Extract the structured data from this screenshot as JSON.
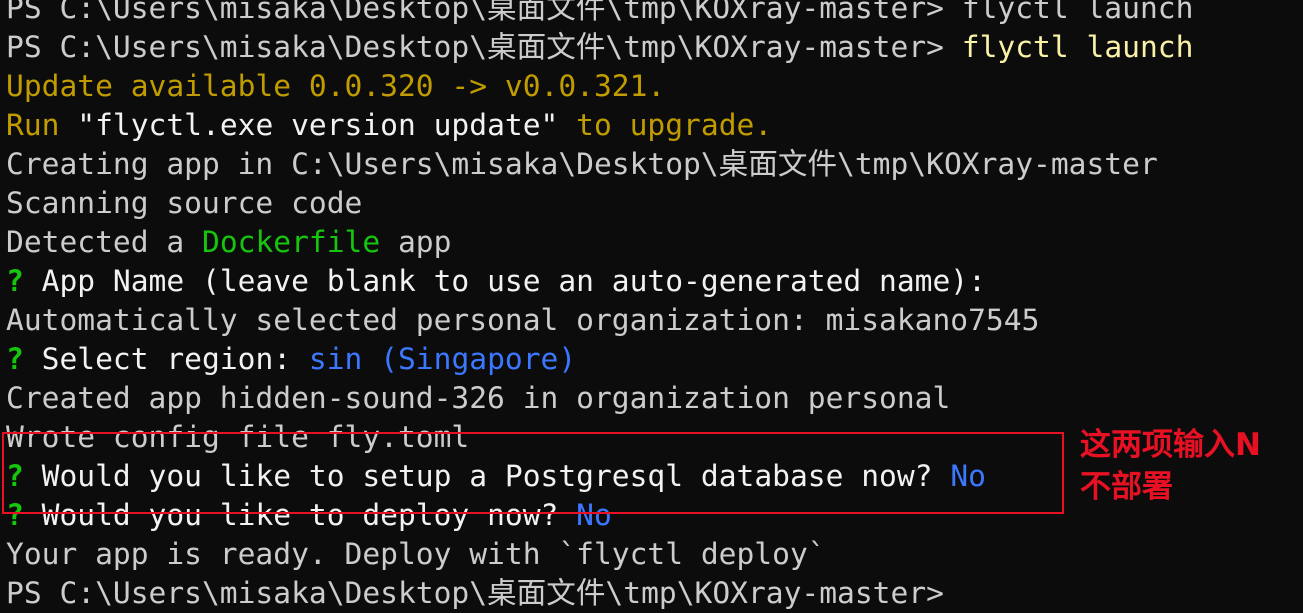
{
  "terminal": {
    "partial_top": "PS C:\\Users\\misaka\\Desktop\\桌面文件\\tmp\\KOXray-master> flyctl launch",
    "prompt1": "PS C:\\Users\\misaka\\Desktop\\桌面文件\\tmp\\KOXray-master> ",
    "command1": "flyctl launch",
    "update_available": "Update available 0.0.320 -> v0.0.321.",
    "run_prefix": "Run ",
    "run_cmd": "\"flyctl.exe version update\"",
    "run_suffix": " to upgrade.",
    "creating_app": "Creating app in C:\\Users\\misaka\\Desktop\\桌面文件\\tmp\\KOXray-master",
    "scanning": "Scanning source code",
    "detected_prefix": "Detected a ",
    "detected_kind": "Dockerfile",
    "detected_suffix": " app",
    "question_mark": "?",
    "app_name_question": " App Name (leave blank to use an auto-generated name):",
    "auto_selected_org": "Automatically selected personal organization: misakano7545",
    "region_question": " Select region: ",
    "region_answer": "sin (Singapore)",
    "created_app": "Created app hidden-sound-326 in organization personal",
    "wrote_config": "Wrote config file fly.toml",
    "postgres_question": " Would you like to setup a Postgresql database now? ",
    "postgres_answer": "No",
    "deploy_question": " Would you like to deploy now? ",
    "deploy_answer": "No",
    "ready": "Your app is ready. Deploy with `flyctl deploy`",
    "prompt2": "PS C:\\Users\\misaka\\Desktop\\桌面文件\\tmp\\KOXray-master>"
  },
  "annotation": {
    "line1": "这两项输入N",
    "line2": "不部署"
  },
  "colors": {
    "background": "#0c0c0c",
    "text": "#cccccc",
    "warning_yellow": "#c19c00",
    "command_yellow": "#f9f1a5",
    "prompt_green": "#16c60c",
    "answer_blue": "#3b78ff",
    "annotation_red": "#e81123"
  }
}
